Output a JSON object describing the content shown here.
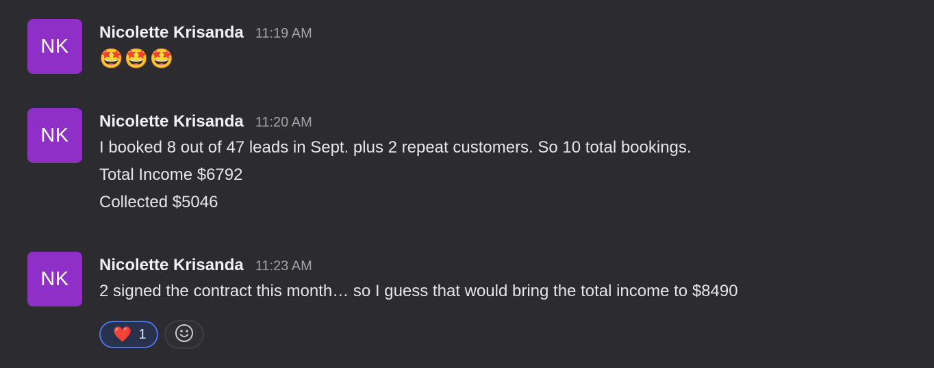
{
  "messages": [
    {
      "avatar_initials": "NK",
      "sender": "Nicolette Krisanda",
      "time": "11:19 AM",
      "emoji_text": "🤩🤩🤩"
    },
    {
      "avatar_initials": "NK",
      "sender": "Nicolette Krisanda",
      "time": "11:20 AM",
      "lines": [
        "I booked 8 out of 47 leads in Sept. plus 2 repeat customers. So 10 total bookings.",
        "Total Income $6792",
        "Collected $5046"
      ]
    },
    {
      "avatar_initials": "NK",
      "sender": "Nicolette Krisanda",
      "time": "11:23 AM",
      "lines": [
        "2 signed the contract this month… so I guess that would bring the total income to $8490"
      ],
      "reactions": [
        {
          "emoji": "❤️",
          "count": "1",
          "icon": "heart-icon"
        }
      ],
      "add_reaction_icon": "smiley-face-icon"
    }
  ],
  "colors": {
    "background": "#2b2b30",
    "avatar": "#8e2fc7",
    "reaction_border": "#4f74e0"
  }
}
